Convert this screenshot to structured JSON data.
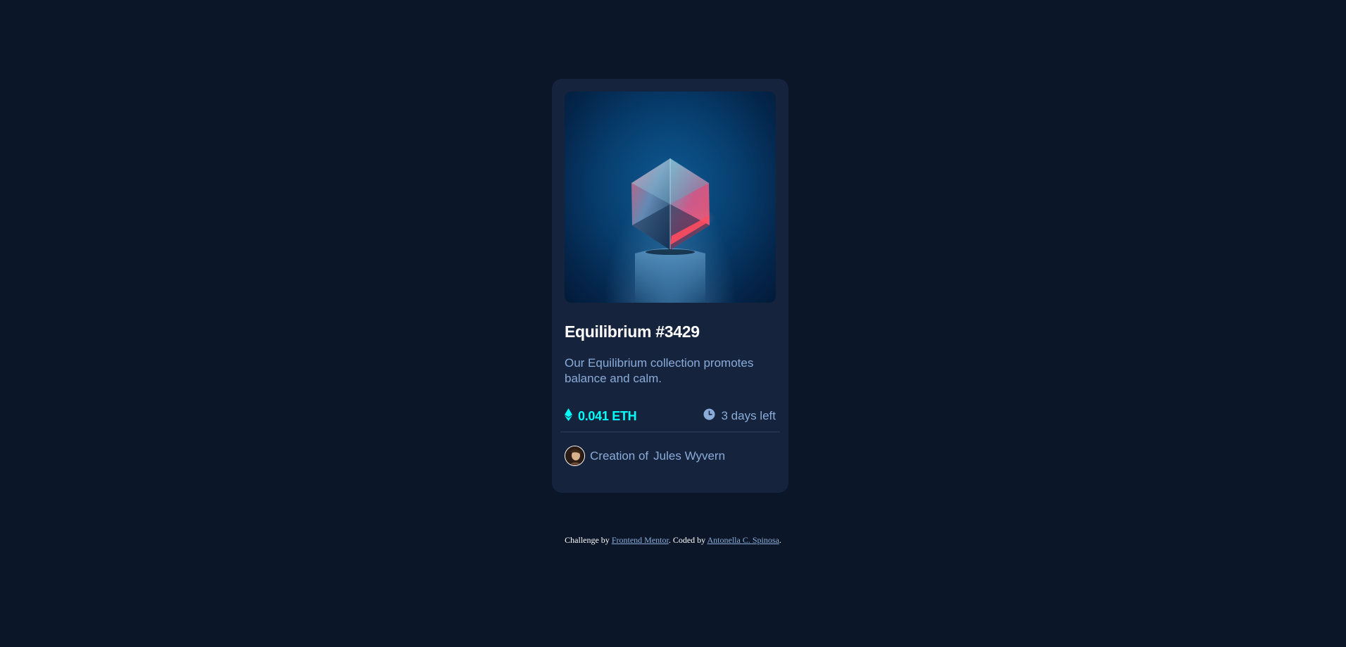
{
  "card": {
    "image_alt": "Equilibrium",
    "title": "Equilibrium #3429",
    "description": "Our Equilibrium collection promotes balance and calm.",
    "price": "0.041 ETH",
    "time_left": "3 days left",
    "creator_prefix": "Creation of",
    "creator_name": "Jules Wyvern",
    "icons": {
      "price": "ethereum-icon",
      "time": "clock-icon"
    }
  },
  "footer": {
    "challenge_prefix": "Challenge by",
    "challenge_link": "Frontend Mentor",
    "coded_prefix": ". Coded by",
    "coded_link": "Antonella C. Spinosa",
    "suffix": "."
  },
  "colors": {
    "page_bg": "#0c1629",
    "card_bg": "#15233d",
    "accent_cyan": "#00fff8",
    "soft_blue": "#8bacd9",
    "white": "#ffffff"
  }
}
